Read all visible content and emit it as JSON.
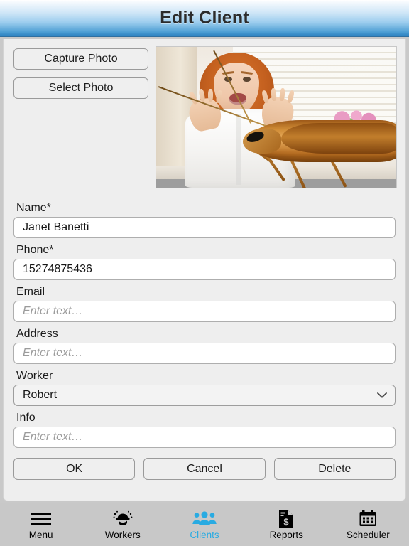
{
  "header": {
    "title": "Edit Client"
  },
  "photo": {
    "capture_label": "Capture Photo",
    "select_label": "Select Photo",
    "alt": "Frightened red-haired woman in white shirt with a large cockroach composited in foreground"
  },
  "form": {
    "fields": [
      {
        "label": "Name*",
        "value": "Janet Banetti",
        "placeholder": "Enter text…",
        "type": "text"
      },
      {
        "label": "Phone*",
        "value": "15274875436",
        "placeholder": "Enter text…",
        "type": "text"
      },
      {
        "label": "Email",
        "value": "",
        "placeholder": "Enter text…",
        "type": "text"
      },
      {
        "label": "Address",
        "value": "",
        "placeholder": "Enter text…",
        "type": "text"
      },
      {
        "label": "Worker",
        "value": "Robert",
        "placeholder": "",
        "type": "select"
      },
      {
        "label": "Info",
        "value": "",
        "placeholder": "Enter text…",
        "type": "text"
      }
    ],
    "worker_icon": "chevron-down-icon"
  },
  "actions": {
    "ok_label": "OK",
    "cancel_label": "Cancel",
    "delete_label": "Delete"
  },
  "tabbar": {
    "active_color": "#29ABE2",
    "inactive_color": "#000000",
    "items": [
      {
        "label": "Menu",
        "icon": "hamburger-menu-icon",
        "active": false
      },
      {
        "label": "Workers",
        "icon": "hard-hat-worker-icon",
        "active": false
      },
      {
        "label": "Clients",
        "icon": "people-group-icon",
        "active": true
      },
      {
        "label": "Reports",
        "icon": "document-dollar-icon",
        "active": false
      },
      {
        "label": "Scheduler",
        "icon": "calendar-icon",
        "active": false
      }
    ]
  }
}
